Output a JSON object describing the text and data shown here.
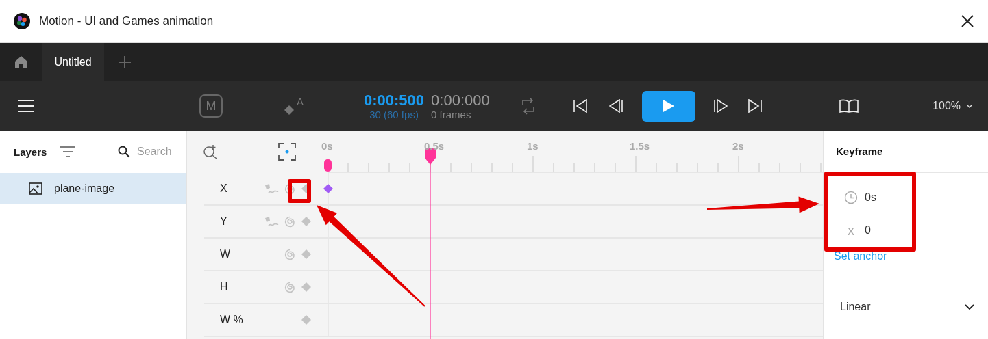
{
  "window": {
    "title": "Motion - UI and Games animation"
  },
  "tabs": [
    {
      "label": "Untitled",
      "selected": true
    }
  ],
  "toolbar": {
    "mode_key": "M",
    "auto_key": "A",
    "current_time": "0:00:500",
    "total_time": "0:00:000",
    "fps": "30 (60 fps)",
    "frames": "0 frames",
    "zoom": "100%"
  },
  "layers": {
    "title": "Layers",
    "search": {
      "placeholder": "Search"
    },
    "items": [
      {
        "name": "plane-image",
        "selected": true
      }
    ]
  },
  "timeline": {
    "ruler": [
      "0s",
      "0.5s",
      "1s",
      "1.5s",
      "2s"
    ],
    "playhead": {
      "level": 0.2075
    },
    "properties": [
      {
        "label": "X",
        "kind": "position",
        "has_keyframe": true
      },
      {
        "label": "Y",
        "kind": "position",
        "has_keyframe": false
      },
      {
        "label": "W",
        "kind": "size",
        "has_keyframe": false
      },
      {
        "label": "H",
        "kind": "size",
        "has_keyframe": false
      },
      {
        "label": "W %",
        "kind": "plain",
        "has_keyframe": false
      }
    ]
  },
  "keyframe_panel": {
    "title": "Keyframe",
    "time": "0s",
    "axis": "x",
    "value": "0",
    "link": "Set anchor",
    "easing": "Linear"
  },
  "annotations": [
    {
      "kind": "box"
    },
    {
      "kind": "arrow"
    },
    {
      "kind": "box"
    },
    {
      "kind": "arrow"
    }
  ]
}
